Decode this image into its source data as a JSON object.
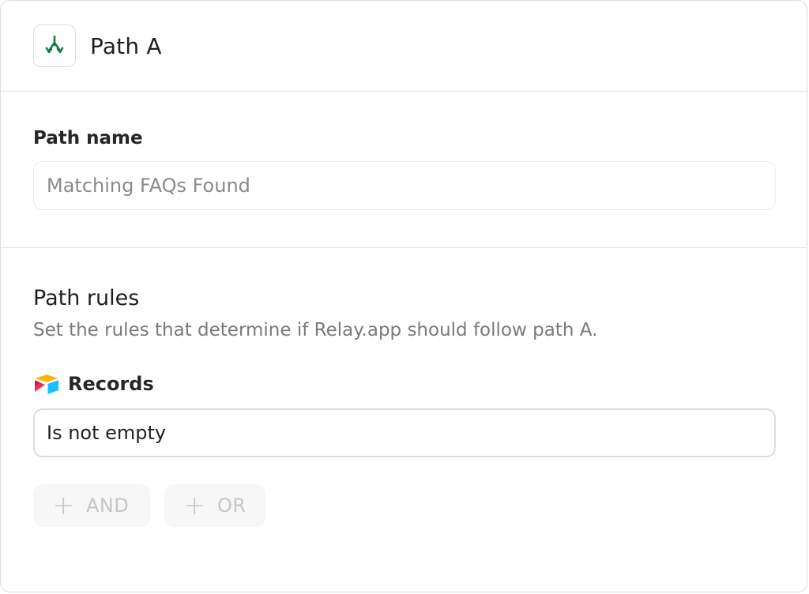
{
  "header": {
    "title": "Path A",
    "icon": "branch-split-icon",
    "icon_color": "#1a7a4c"
  },
  "path_name": {
    "label": "Path name",
    "value": "Matching FAQs Found"
  },
  "path_rules": {
    "title": "Path rules",
    "description": "Set the rules that determine if Relay.app should follow path A.",
    "field": {
      "icon": "airtable-icon",
      "label": "Records",
      "condition": "Is not empty"
    },
    "buttons": {
      "and_label": "AND",
      "or_label": "OR",
      "plus_glyph": "+"
    }
  }
}
